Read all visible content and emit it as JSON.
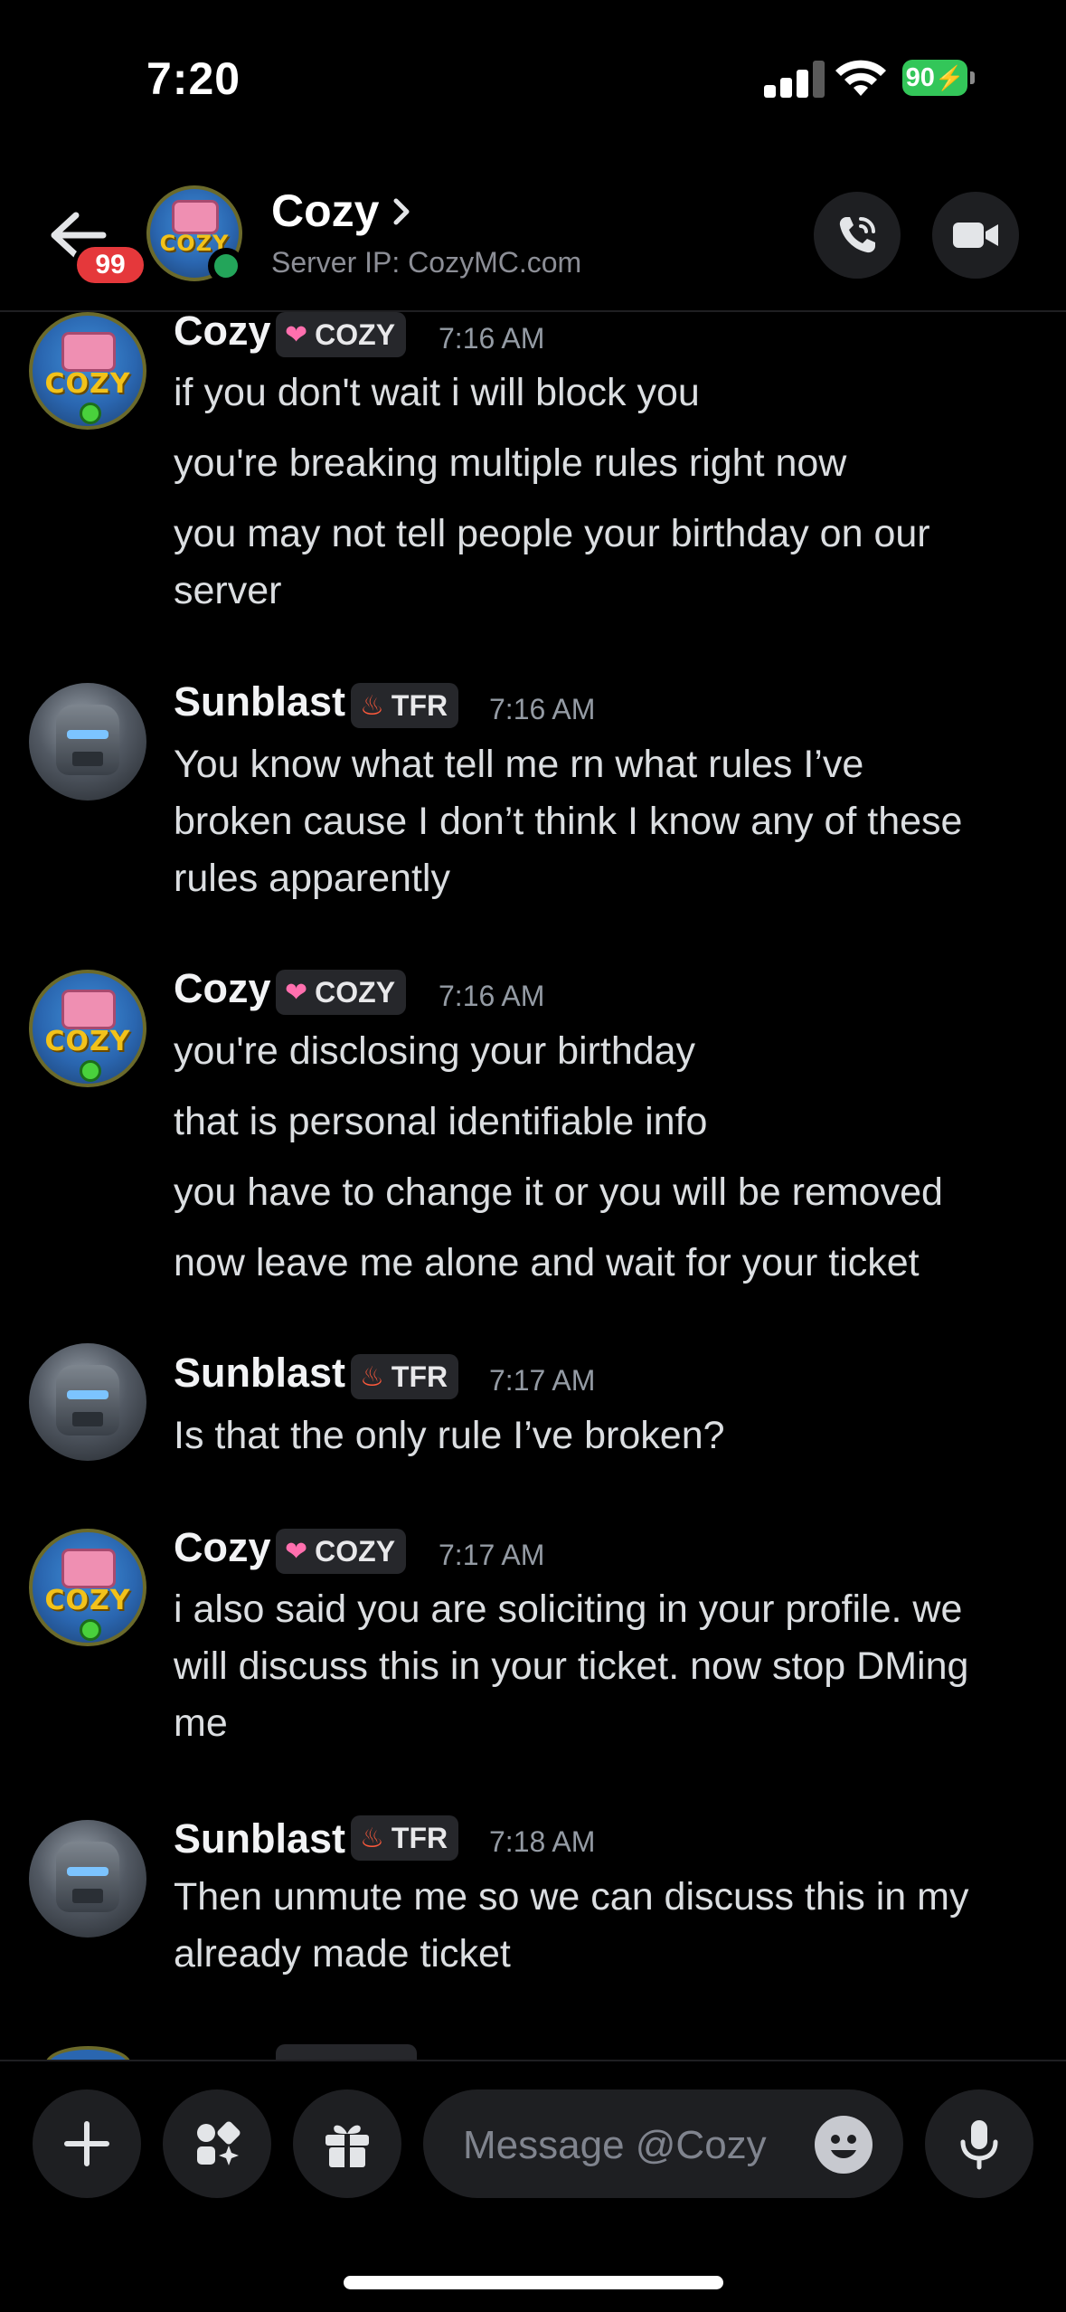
{
  "status": {
    "time": "7:20",
    "battery": "90"
  },
  "header": {
    "title": "Cozy",
    "subtitle": "Server IP: CozyMC.com",
    "unread_count": "99"
  },
  "messages": [
    {
      "author": "Cozy",
      "tag": "COZY",
      "time": "7:16 AM",
      "lines": [
        "if you don't wait i will block you",
        "you're breaking multiple rules right now",
        "you may not tell people your birthday on our",
        "server"
      ]
    },
    {
      "author": "Sunblast",
      "tag": "TFR",
      "time": "7:16 AM",
      "lines": [
        "You know what tell me rn what rules I’ve",
        "broken cause I don’t think I know any of these",
        "rules apparently"
      ]
    },
    {
      "author": "Cozy",
      "tag": "COZY",
      "time": "7:16 AM",
      "lines": [
        "you're disclosing your birthday",
        "that is personal identifiable info",
        "you have to change it or you will be removed",
        "now leave me alone and wait for your ticket"
      ]
    },
    {
      "author": "Sunblast",
      "tag": "TFR",
      "time": "7:17 AM",
      "lines": [
        "Is that the only rule I’ve broken?"
      ]
    },
    {
      "author": "Cozy",
      "tag": "COZY",
      "time": "7:17 AM",
      "lines": [
        "i also said you are soliciting in your profile. we",
        "will discuss this in your ticket. now stop DMing",
        "me"
      ]
    },
    {
      "author": "Sunblast",
      "tag": "TFR",
      "time": "7:18 AM",
      "lines": [
        "Then unmute me so we can discuss this in my",
        "already made ticket"
      ]
    }
  ],
  "composer": {
    "placeholder": "Message @Cozy"
  },
  "avatar_art": {
    "cozy_logo_text": "COZY"
  },
  "colors": {
    "background": "#000000",
    "online": "#23a55a",
    "badge": "#e5383b",
    "battery": "#33c659",
    "cozy_tag_icon": "#ff6fae",
    "tfr_tag_icon": "#ff5a3c"
  }
}
